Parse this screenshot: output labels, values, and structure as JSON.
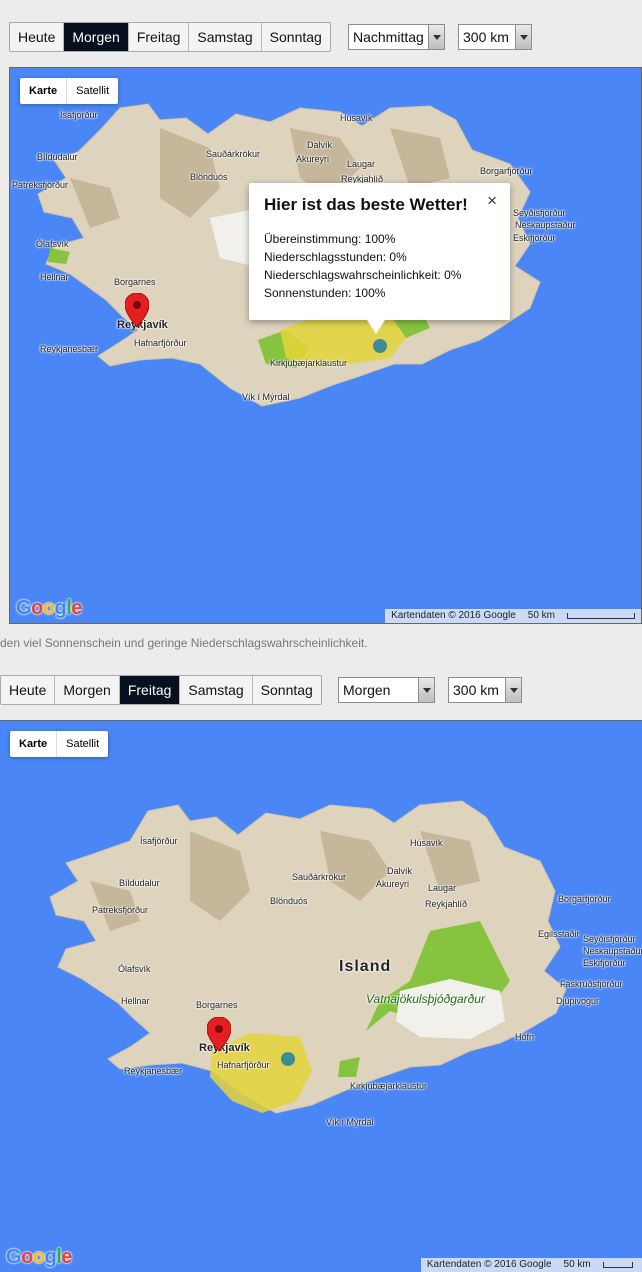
{
  "toolbar1": {
    "days": [
      "Heute",
      "Morgen",
      "Freitag",
      "Samstag",
      "Sonntag"
    ],
    "active": "Morgen",
    "time_select": "Nachmittag",
    "distance_select": "300 km"
  },
  "map1": {
    "map_type": [
      "Karte",
      "Satellit"
    ],
    "labels": [
      "Ísafjörður",
      "Bíldudalur",
      "Patreksfjörður",
      "Ólafsvík",
      "Hellnar",
      "Borgarnes",
      "Reykjavík",
      "Hafnarfjörður",
      "Reykjanesbær",
      "Húsavík",
      "Sauðárkrókur",
      "Dalvík",
      "Akureyri",
      "Blönduós",
      "Laugar",
      "Reykjahlíð",
      "Borgarfjörður",
      "Seyðisfjörður",
      "Neskaupstaður",
      "Eskifjörður",
      "Kirkjubæjarklaustur",
      "Vík í Mýrdal"
    ],
    "info_window": {
      "title": "Hier ist das beste Wetter!",
      "close": "×",
      "lines": [
        "Übereinstimmung: 100%",
        "Niederschlagsstunden: 0%",
        "Niederschlagswahrscheinlichkeit: 0%",
        "Sonnenstunden: 100%"
      ]
    },
    "google_logo": "Google",
    "attribution": "Kartendaten © 2016 Google",
    "scale": "50 km"
  },
  "between_text": "den viel Sonnenschein und geringe Niederschlagswahrscheinlichkeit.",
  "toolbar2": {
    "days": [
      "Heute",
      "Morgen",
      "Freitag",
      "Samstag",
      "Sonntag"
    ],
    "active": "Freitag",
    "time_select": "Morgen",
    "distance_select": "300 km"
  },
  "map2": {
    "map_type": [
      "Karte",
      "Satellit"
    ],
    "labels": [
      "Ísafjörður",
      "Bíldudalur",
      "Patreksfjörður",
      "Ólafsvík",
      "Hellnar",
      "Borgarnes",
      "Reykjavík",
      "Hafnarfjörður",
      "Reykjanesbær",
      "Húsavík",
      "Sauðárkrókur",
      "Dalvík",
      "Akureyri",
      "Blönduós",
      "Laugar",
      "Reykjahlíð",
      "Borgarfjörður",
      "Egilsstaðir",
      "Seyðisfjörður",
      "Neskaupstaður",
      "Eskifjörður",
      "Fáskrúðsfjörður",
      "Djúpivogur",
      "Höfn",
      "Kirkjubæjarklaustur",
      "Vík í Mýrdal",
      "Island",
      "Vatnajökulsþjóðgarður"
    ],
    "google_logo": "Google",
    "attribution": "Kartendaten © 2016 Google",
    "scale": "50 km",
    "scale_cut": "N"
  },
  "colors": {
    "water": "#4a86f5",
    "land": "#ded3bd",
    "active_tab": "#07101f",
    "park": "#86c440",
    "highlight": "#e3d53a",
    "pin": "#e51f1f"
  }
}
